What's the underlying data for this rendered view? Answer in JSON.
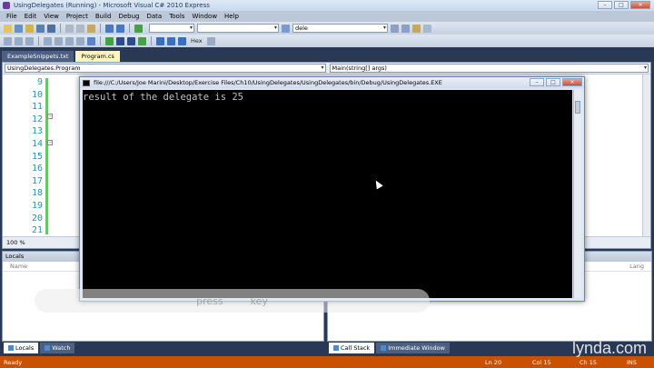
{
  "window": {
    "title": "UsingDelegates (Running) - Microsoft Visual C# 2010 Express",
    "buttons": [
      "–",
      "□",
      "✕"
    ]
  },
  "menu": [
    "File",
    "Edit",
    "View",
    "Project",
    "Build",
    "Debug",
    "Data",
    "Tools",
    "Window",
    "Help"
  ],
  "toolbar": {
    "find_value": "dele",
    "hex_label": "Hex"
  },
  "tabs": [
    {
      "label": "ExampleSnippets.txt",
      "active": false
    },
    {
      "label": "Program.cs",
      "active": true
    }
  ],
  "editor": {
    "class_combo": "UsingDelegates.Program",
    "member_combo": "Main(string[] args)",
    "line_numbers": [
      "9",
      "10",
      "11",
      "12",
      "13",
      "14",
      "15",
      "16",
      "17",
      "18",
      "19",
      "20",
      "21"
    ],
    "zoom": "100 %"
  },
  "locals": {
    "title": "Locals",
    "col_name": "Name",
    "col_lang": "Lang"
  },
  "bottom_tabs_left": [
    "Locals",
    "Watch"
  ],
  "bottom_tabs_right": [
    "Call Stack",
    "Immediate Window"
  ],
  "console": {
    "path": "file:///C:/Users/Joe Marini/Desktop/Exercise Files/Ch10/UsingDelegates/UsingDelegates/bin/Debug/UsingDelegates.EXE",
    "output": "result of the delegate is 25"
  },
  "overlay": {
    "word1": "press",
    "word2": "key"
  },
  "status": {
    "message": "Ready",
    "ln": "Ln 20",
    "col": "Col 15",
    "ch": "Ch 15",
    "ins": "INS"
  },
  "watermark": "lynda.com"
}
